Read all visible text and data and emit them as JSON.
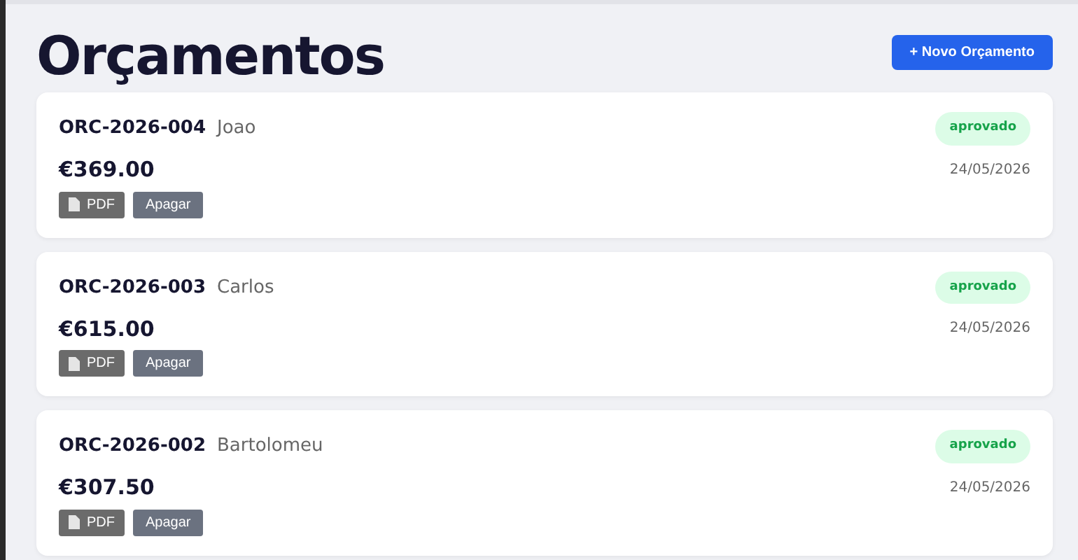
{
  "title": "Orçamentos",
  "new_button": "+ Novo Orçamento",
  "quotes": [
    {
      "code": "ORC-2026-004",
      "client": "Joao",
      "status": "aprovado",
      "amount": "€369.00",
      "date": "24/05/2026",
      "pdf_button": "PDF",
      "delete_button": "Apagar"
    },
    {
      "code": "ORC-2026-003",
      "client": "Carlos",
      "status": "aprovado",
      "amount": "€615.00",
      "date": "24/05/2026",
      "pdf_button": "PDF",
      "delete_button": "Apagar"
    },
    {
      "code": "ORC-2026-002",
      "client": "Bartolomeu",
      "status": "aprovado",
      "amount": "€307.50",
      "date": "24/05/2026",
      "pdf_button": "PDF",
      "delete_button": "Apagar"
    }
  ]
}
